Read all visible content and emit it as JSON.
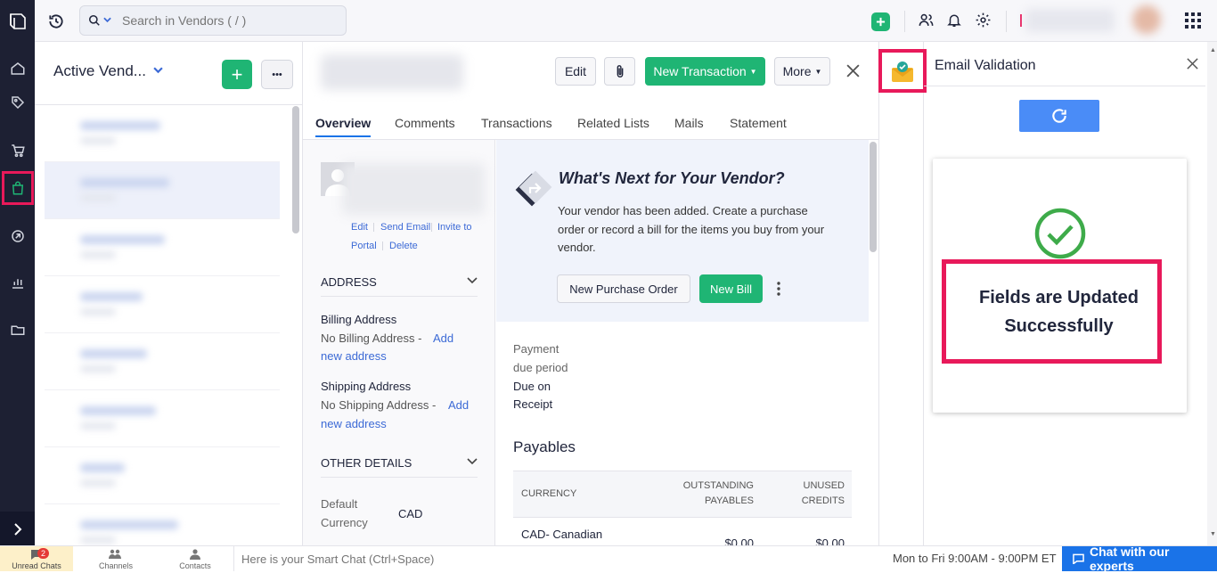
{
  "topbar": {
    "search_placeholder": "Search in Vendors ( / )"
  },
  "list": {
    "title": "Active Vend...",
    "add_label": "+",
    "more_label": "•••"
  },
  "detail": {
    "actions": {
      "edit": "Edit",
      "new_transaction": "New Transaction",
      "more": "More"
    },
    "tabs": [
      "Overview",
      "Comments",
      "Transactions",
      "Related Lists",
      "Mails",
      "Statement"
    ],
    "contact_links": {
      "edit": "Edit",
      "send_email": "Send Email",
      "invite_to": "Invite to",
      "portal": "Portal",
      "delete": "Delete"
    },
    "address": {
      "heading": "ADDRESS",
      "billing_label": "Billing Address",
      "billing_none": "No Billing Address -",
      "shipping_label": "Shipping Address",
      "shipping_none": "No Shipping Address -",
      "add_text": "Add",
      "new_address": "new address"
    },
    "other_details": {
      "heading": "OTHER DETAILS",
      "currency_label_1": "Default",
      "currency_label_2": "Currency",
      "currency_value": "CAD"
    },
    "whats_next": {
      "title": "What's Next for Your Vendor?",
      "line1": "Your vendor has been added. Create a purchase",
      "line2": "order or record a bill for the items you buy from your",
      "line3": "vendor.",
      "new_po": "New Purchase Order",
      "new_bill": "New Bill"
    },
    "payment": {
      "label_1": "Payment",
      "label_2": "due period",
      "value_1": "Due on",
      "value_2": "Receipt"
    },
    "payables": {
      "heading": "Payables",
      "col_currency": "CURRENCY",
      "col_outstanding_1": "OUTSTANDING",
      "col_outstanding_2": "PAYABLES",
      "col_unused_1": "UNUSED",
      "col_unused_2": "CREDITS",
      "row_currency": "CAD- Canadian",
      "row_outstanding": "$0.00",
      "row_unused": "$0.00"
    }
  },
  "email_panel": {
    "title": "Email Validation",
    "message_1": "Fields are Updated",
    "message_2": "Successfully"
  },
  "bottombar": {
    "unread_badge": "2",
    "unread_label": "Unread Chats",
    "channels_label": "Channels",
    "contacts_label": "Contacts",
    "smart_chat_placeholder": "Here is your Smart Chat (Ctrl+Space)",
    "hours": "Mon to Fri 9:00AM - 9:00PM ET",
    "chat_experts": "Chat with our experts"
  },
  "colors": {
    "accent_green": "#1fb574",
    "accent_blue": "#1a73e8",
    "highlight_pink": "#e8195a",
    "rail_bg": "#1d2033"
  }
}
